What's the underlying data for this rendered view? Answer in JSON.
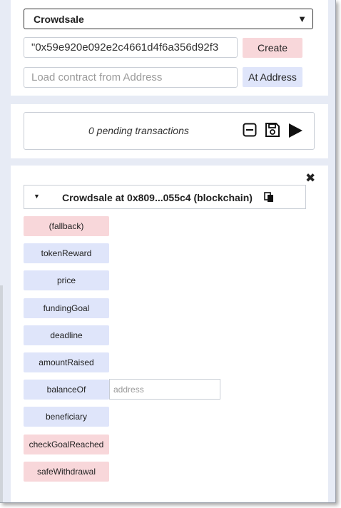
{
  "compile_panel": {
    "contract_select": "Crowdsale",
    "constructor_input_value": "\"0x59e920e092e2c4661d4f6a356d92f3",
    "create_label": "Create",
    "address_placeholder": "Load contract from Address",
    "at_address_label": "At Address"
  },
  "transactions": {
    "pending_text": "0 pending transactions",
    "icons": [
      "minus-square-icon",
      "save-icon",
      "play-icon"
    ]
  },
  "instance": {
    "close_glyph": "✖",
    "title": "Crowdsale at 0x809...055c4 (blockchain)",
    "functions": [
      {
        "label": "(fallback)",
        "kind": "payable"
      },
      {
        "label": "tokenReward",
        "kind": "constant"
      },
      {
        "label": "price",
        "kind": "constant"
      },
      {
        "label": "fundingGoal",
        "kind": "constant"
      },
      {
        "label": "deadline",
        "kind": "constant"
      },
      {
        "label": "amountRaised",
        "kind": "constant"
      },
      {
        "label": "balanceOf",
        "kind": "constant",
        "input_placeholder": "address"
      },
      {
        "label": "beneficiary",
        "kind": "constant"
      },
      {
        "label": "checkGoalReached",
        "kind": "transact"
      },
      {
        "label": "safeWithdrawal",
        "kind": "transact"
      }
    ]
  },
  "colors": {
    "panel_background": "#e7ebf5",
    "constant_button": "#dfe5fa",
    "transact_button": "#f8d7da"
  }
}
